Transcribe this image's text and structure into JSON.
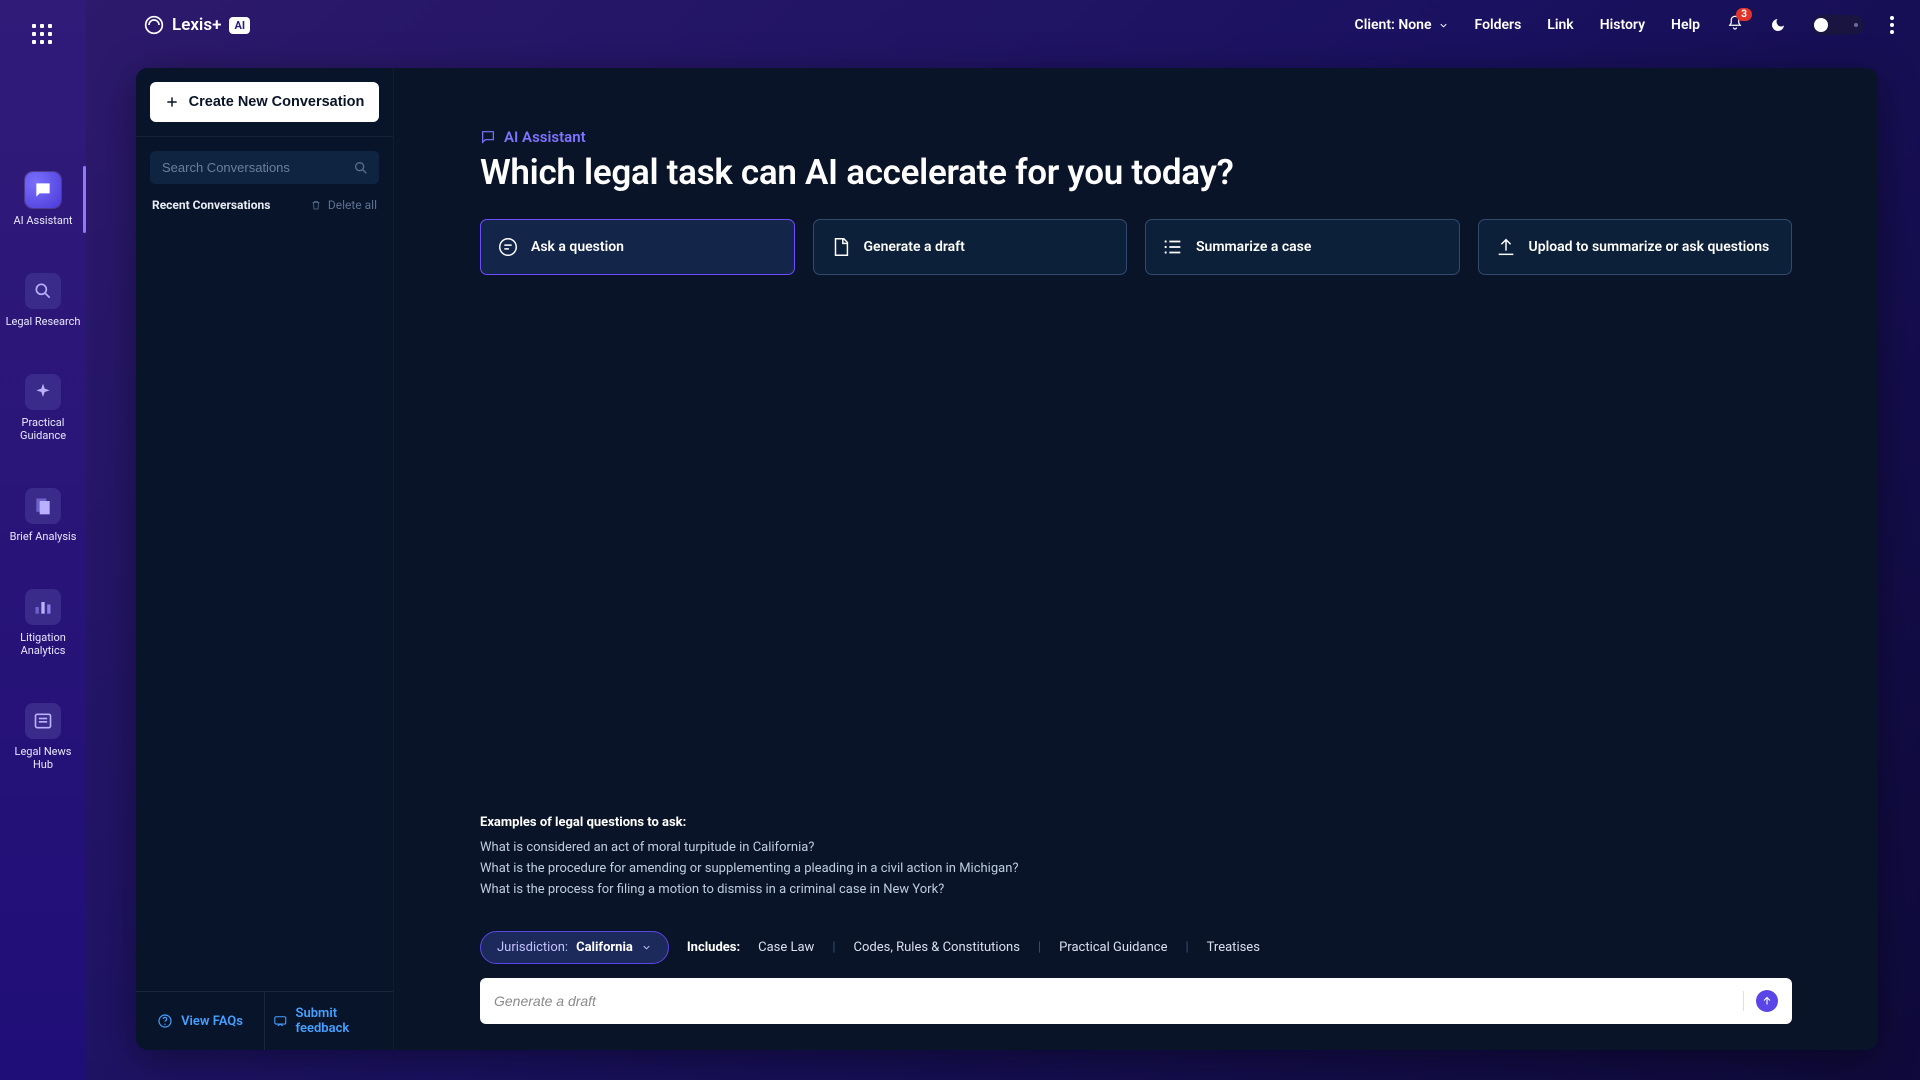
{
  "brand": {
    "name": "Lexis+",
    "badge": "AI"
  },
  "topnav": {
    "client_label": "Client: None",
    "links": {
      "folders": "Folders",
      "link": "Link",
      "history": "History",
      "help": "Help"
    },
    "notifications_count": "3"
  },
  "rail": {
    "items": [
      {
        "id": "ai-assistant",
        "label": "AI Assistant",
        "active": true
      },
      {
        "id": "legal-research",
        "label": "Legal Research"
      },
      {
        "id": "practical-guidance",
        "label": "Practical Guidance"
      },
      {
        "id": "brief-analysis",
        "label": "Brief Analysis"
      },
      {
        "id": "litigation-analytics",
        "label": "Litigation Analytics"
      },
      {
        "id": "legal-news-hub",
        "label": "Legal News Hub"
      }
    ]
  },
  "sidebar": {
    "create_label": "Create New Conversation",
    "search_placeholder": "Search Conversations",
    "recent_label": "Recent Conversations",
    "delete_all_label": "Delete all",
    "footer": {
      "faqs": "View FAQs",
      "feedback": "Submit feedback"
    }
  },
  "content": {
    "assistant_tag": "AI Assistant",
    "hero": "Which legal task can AI accelerate for you today?",
    "cards": {
      "ask": "Ask a question",
      "draft": "Generate a draft",
      "summarize": "Summarize a case",
      "upload": "Upload to summarize or ask questions"
    },
    "examples_header": "Examples of legal questions to ask:",
    "examples": [
      "What is considered an act of moral turpitude in California?",
      "What is the procedure for amending or supplementing a pleading in a civil action in Michigan?",
      "What is the process for filing a motion to dismiss in a criminal case in New York?"
    ],
    "filters": {
      "jurisdiction_label": "Jurisdiction:",
      "jurisdiction_value": "California",
      "includes_label": "Includes:",
      "items": [
        "Case Law",
        "Codes, Rules & Constitutions",
        "Practical Guidance",
        "Treatises"
      ]
    },
    "compose_placeholder": "Generate a draft"
  },
  "colors": {
    "accent": "#5a45e6",
    "link": "#45a0ff"
  }
}
